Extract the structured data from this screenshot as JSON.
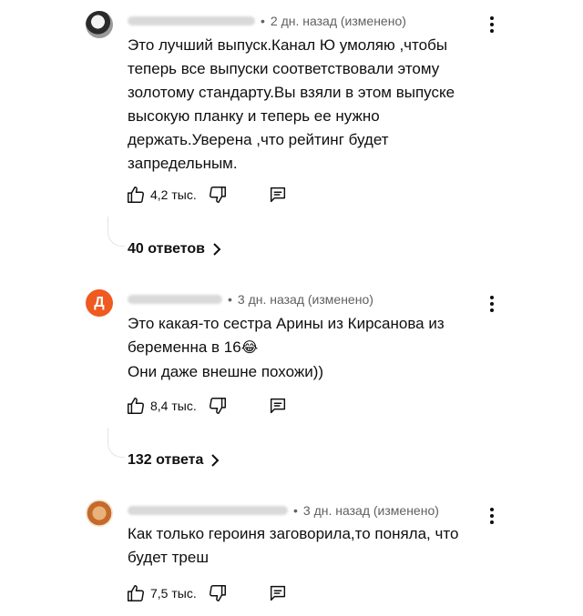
{
  "comments": [
    {
      "avatar": "",
      "time": "2 дн. назад (изменено)",
      "lines": [
        "Это лучший выпуск.Канал Ю умоляю ,чтобы",
        "теперь все выпуски соответствовали этому",
        "золотому стандарту.Вы взяли в этом выпуске",
        "высокую планку и теперь ее нужно",
        "держать.Уверена ,что рейтинг будет",
        "запредельным."
      ],
      "likes": "4,2 тыс.",
      "replies": "40 ответов"
    },
    {
      "avatar": "Д",
      "time": "3 дн. назад (изменено)",
      "lines": [
        "Это какая-то сестра Арины из Кирсанова из",
        "беременна в 16",
        "Они даже внешне похожи))"
      ],
      "emoji": "😂",
      "likes": "8,4 тыс.",
      "replies": "132 ответа"
    },
    {
      "avatar": "",
      "time": "3 дн. назад (изменено)",
      "lines": [
        "Как только героиня заговорила,то поняла, что",
        "будет треш"
      ],
      "likes": "7,5 тыс."
    }
  ],
  "icons": {
    "like": "thumb-up-icon",
    "dislike": "thumb-down-icon",
    "reply": "reply-icon",
    "more": "more-vertical-icon",
    "chevron": "chevron-right-icon"
  }
}
